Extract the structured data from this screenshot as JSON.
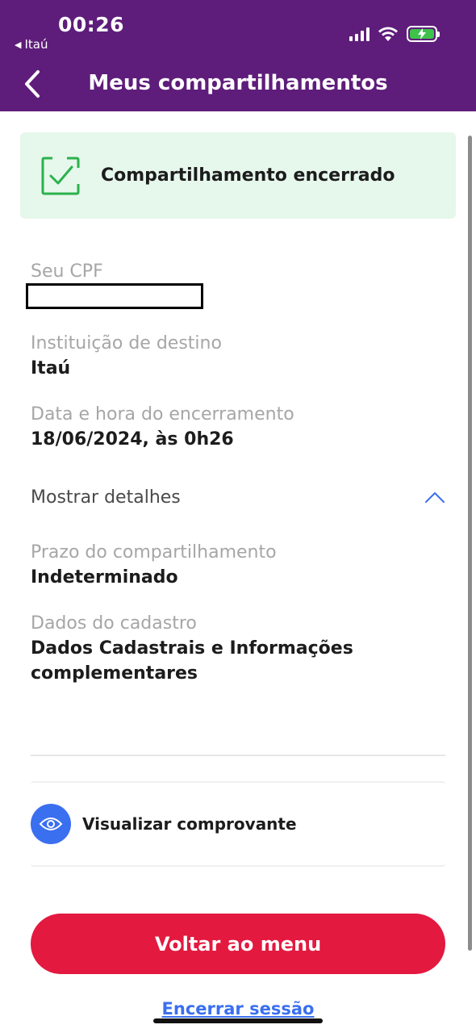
{
  "status_bar": {
    "time": "00:26",
    "back_app": "Itaú"
  },
  "nav": {
    "title": "Meus compartilhamentos"
  },
  "banner": {
    "text": "Compartilhamento encerrado",
    "color": "#e6f7ec"
  },
  "fields": {
    "cpf_label": "Seu CPF",
    "institution_label": "Instituição de destino",
    "institution_value": "Itaú",
    "end_date_label": "Data e hora do encerramento",
    "end_date_value": "18/06/2024, às 0h26",
    "deadline_label": "Prazo do compartilhamento",
    "deadline_value": "Indeterminado",
    "registry_label": "Dados do cadastro",
    "registry_value": "Dados Cadastrais e Informações complementares"
  },
  "details_toggle": {
    "label": "Mostrar detalhes",
    "icon": "chevron-up-icon"
  },
  "receipt": {
    "label": "Visualizar comprovante",
    "icon": "eye-icon"
  },
  "actions": {
    "primary_label": "Voltar ao menu",
    "logout_label": "Encerrar sessão"
  },
  "colors": {
    "header": "#5e1d7a",
    "primary_button": "#e3193f",
    "accent_blue": "#3a6ff0",
    "success_green": "#2bb24c"
  }
}
